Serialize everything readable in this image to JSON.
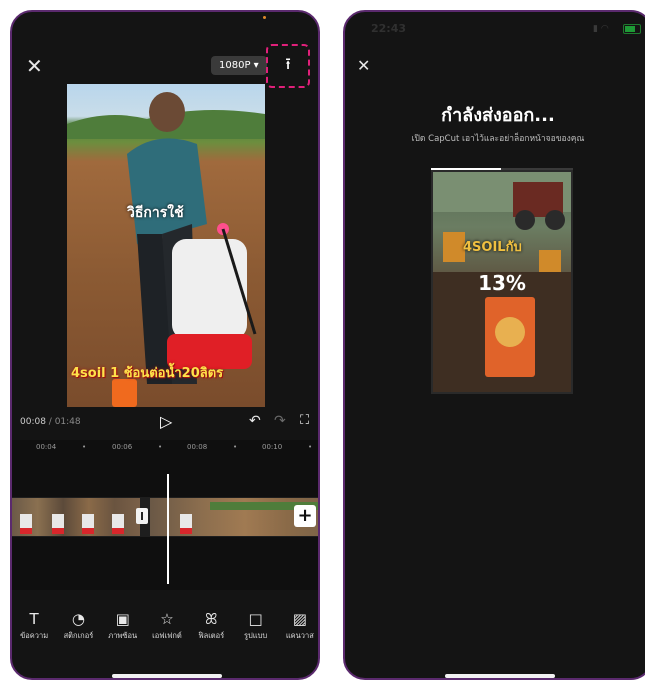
{
  "editor": {
    "close_glyph": "✕",
    "resolution": "1080P",
    "resolution_caret": "▾",
    "export_glyph": "⭱",
    "overlay_text_top": "วิธีการใช้",
    "overlay_text_bottom": "4soil 1 ช้อนต่อน้ำ20ลิตร",
    "current_time": "00:08",
    "total_time": " / 01:48",
    "play_glyph": "▷",
    "undo_glyph": "↶",
    "redo_glyph": "↷",
    "fullscreen_glyph": "⛶",
    "ruler": [
      "00:04",
      "00:06",
      "00:08",
      "00:10"
    ],
    "add_glyph": "+",
    "toolbar": [
      {
        "icon": "T",
        "label": "ข้อความ"
      },
      {
        "icon": "◔",
        "label": "สติกเกอร์"
      },
      {
        "icon": "▣",
        "label": "ภาพซ้อน"
      },
      {
        "icon": "☆",
        "label": "เอฟเฟกต์"
      },
      {
        "icon": "ꕤ",
        "label": "ฟิลเตอร์"
      },
      {
        "icon": "□",
        "label": "รูปแบบ"
      },
      {
        "icon": "▨",
        "label": "แคนวาส"
      }
    ]
  },
  "exporting": {
    "status_time": "22:43",
    "close_glyph": "✕",
    "title": "กำลังส่งออก...",
    "subtitle": "เปิด CapCut เอาไว้และอย่าล็อกหน้าจอของคุณ",
    "progress_percent": 13,
    "percent_label": "13%",
    "thumb_text": "4SOILกับ"
  },
  "colors": {
    "accent_dashed": "#e0207a",
    "phone_border": "#5b2a6e",
    "background_dark": "#141414"
  }
}
